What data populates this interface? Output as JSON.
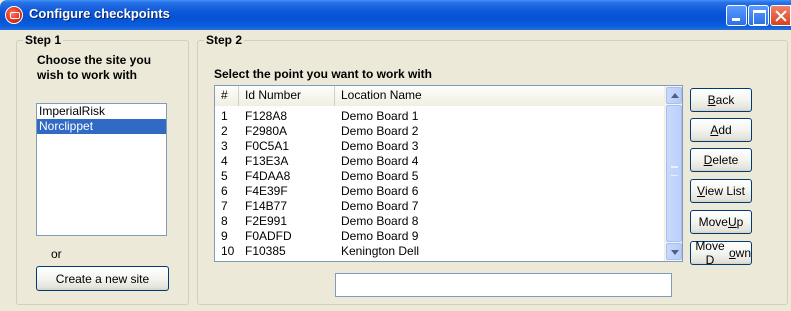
{
  "window": {
    "title": "Configure checkpoints"
  },
  "step1": {
    "legend": "Step 1",
    "heading_line1": "Choose the site you",
    "heading_line2": "wish to work with",
    "sites": [
      {
        "label": "ImperialRisk",
        "selected": false
      },
      {
        "label": "Norclippet",
        "selected": true
      }
    ],
    "or_label": "or",
    "create_button": "Create a new site"
  },
  "step2": {
    "legend": "Step 2",
    "heading": "Select the point you want to work with",
    "columns": [
      "#",
      "Id Number",
      "Location Name"
    ],
    "rows": [
      [
        "1",
        "F128A8",
        "Demo Board 1"
      ],
      [
        "2",
        "F2980A",
        "Demo Board 2"
      ],
      [
        "3",
        "F0C5A1",
        "Demo Board 3"
      ],
      [
        "4",
        "F13E3A",
        "Demo Board 4"
      ],
      [
        "5",
        "F4DAA8",
        "Demo Board 5"
      ],
      [
        "6",
        "F4E39F",
        "Demo Board 6"
      ],
      [
        "7",
        "F14B77",
        "Demo Board 7"
      ],
      [
        "8",
        "F2E991",
        "Demo Board 8"
      ],
      [
        "9",
        "F0ADFD",
        "Demo Board 9"
      ],
      [
        "10",
        "F10385",
        "Kenington Dell"
      ]
    ],
    "edit_value": ""
  },
  "buttons": {
    "back": {
      "pre": "",
      "key": "B",
      "post": "ack"
    },
    "add": {
      "pre": "",
      "key": "A",
      "post": "dd"
    },
    "delete": {
      "pre": "",
      "key": "D",
      "post": "elete"
    },
    "view_list": {
      "pre": "",
      "key": "V",
      "post": "iew List"
    },
    "move_up": {
      "pre": "Move ",
      "key": "U",
      "post": "p"
    },
    "move_down": {
      "pre": "Move D",
      "key": "o",
      "post": "wn"
    }
  },
  "colors": {
    "titlebar": "#0a57d8",
    "selection": "#316ac5",
    "window_bg": "#ece9d8"
  }
}
